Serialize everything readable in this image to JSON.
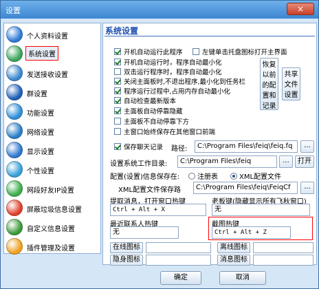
{
  "window": {
    "title": "设置",
    "close_label": "×"
  },
  "sidebar": {
    "items": [
      {
        "label": "个人资料设置",
        "icon": "profile-icon",
        "color": "#2f7ad8"
      },
      {
        "label": "系统设置",
        "icon": "system-icon",
        "color": "#3aa55a"
      },
      {
        "label": "发送接收设置",
        "icon": "send-receive-icon",
        "color": "#3a86d0"
      },
      {
        "label": "群设置",
        "icon": "group-icon",
        "color": "#1e5fb8"
      },
      {
        "label": "功能设置",
        "icon": "function-icon",
        "color": "#2d8fd8"
      },
      {
        "label": "网络设置",
        "icon": "network-icon",
        "color": "#2a7fc8"
      },
      {
        "label": "显示设置",
        "icon": "display-icon",
        "color": "#2f78d0"
      },
      {
        "label": "个性设置",
        "icon": "personalize-icon",
        "color": "#35a0d8"
      },
      {
        "label": "网段好友IP设置",
        "icon": "ip-icon",
        "color": "#3cae4a"
      },
      {
        "label": "屏蔽垃圾信息设置",
        "icon": "block-spam-icon",
        "color": "#e0402a"
      },
      {
        "label": "自定义信息设置",
        "icon": "custom-info-icon",
        "color": "#3a9a3a"
      },
      {
        "label": "插件管理及设置",
        "icon": "plugin-icon",
        "color": "#f0a020"
      }
    ],
    "selected": "系统设置"
  },
  "main": {
    "heading": "系统设置",
    "checkboxes": [
      {
        "label": "开机自动运行此程序",
        "checked": true
      },
      {
        "label": "左键单击托盘图标打开主界面",
        "checked": false
      },
      {
        "label": "开机自动运行时，程序自动最小化",
        "checked": true
      },
      {
        "label": "双击运行程序时，程序自动最小化",
        "checked": false
      },
      {
        "label": "关闭主面板时,不退出程序,最小化到任务栏",
        "checked": true
      },
      {
        "label": "程序运行过程中,占用内存自动最小化",
        "checked": true
      },
      {
        "label": "自动检查最新版本",
        "checked": true
      },
      {
        "label": "主面板自动停靠隐藏",
        "checked": true
      },
      {
        "label": "主面板不自动停靠下方",
        "checked": false
      },
      {
        "label": "主窗口始终保存在其他窗口前端",
        "checked": false
      },
      {
        "label": "保存聊天记录",
        "checked": true
      }
    ],
    "restore_button": "恢复以前的配置和记录",
    "share_button": "共享文件设置",
    "path_label": "路径:",
    "path_value": "C:\\Program Files\\feiq\\feiq.fq",
    "browse1": "...",
    "workdir_label": "设置系统工作目录:",
    "workdir_value": "C:\\Program Files\\feiq",
    "browse2": "...",
    "open_button": "打开",
    "config_label": "配置(设置)信息保存在:",
    "config_options": [
      {
        "label": "注册表",
        "selected": false
      },
      {
        "label": "XML配置文件",
        "selected": true
      }
    ],
    "xml_path_label": "XML配置文件保存路",
    "xml_path_value": "C:\\Program Files\\feiq\\FeiqCf",
    "browse3": "...",
    "hotkey_extract_label": "提取消息，打开窗口热键",
    "hotkey_extract_value": "Ctrl + Alt + X",
    "boss_key_label": "老板键(隐藏显示所有飞秋窗口)",
    "boss_key_value": "无",
    "recent_contact_label": "最近联系人热键",
    "recent_contact_value": "无",
    "screenshot_key_label": "截图热键",
    "screenshot_key_value": "Ctrl + Alt + Z",
    "icon_buttons": [
      "在线图标",
      "离线图标",
      "隐身图标",
      "消息图标"
    ]
  },
  "footer": {
    "ok": "确定",
    "cancel": "取消"
  }
}
